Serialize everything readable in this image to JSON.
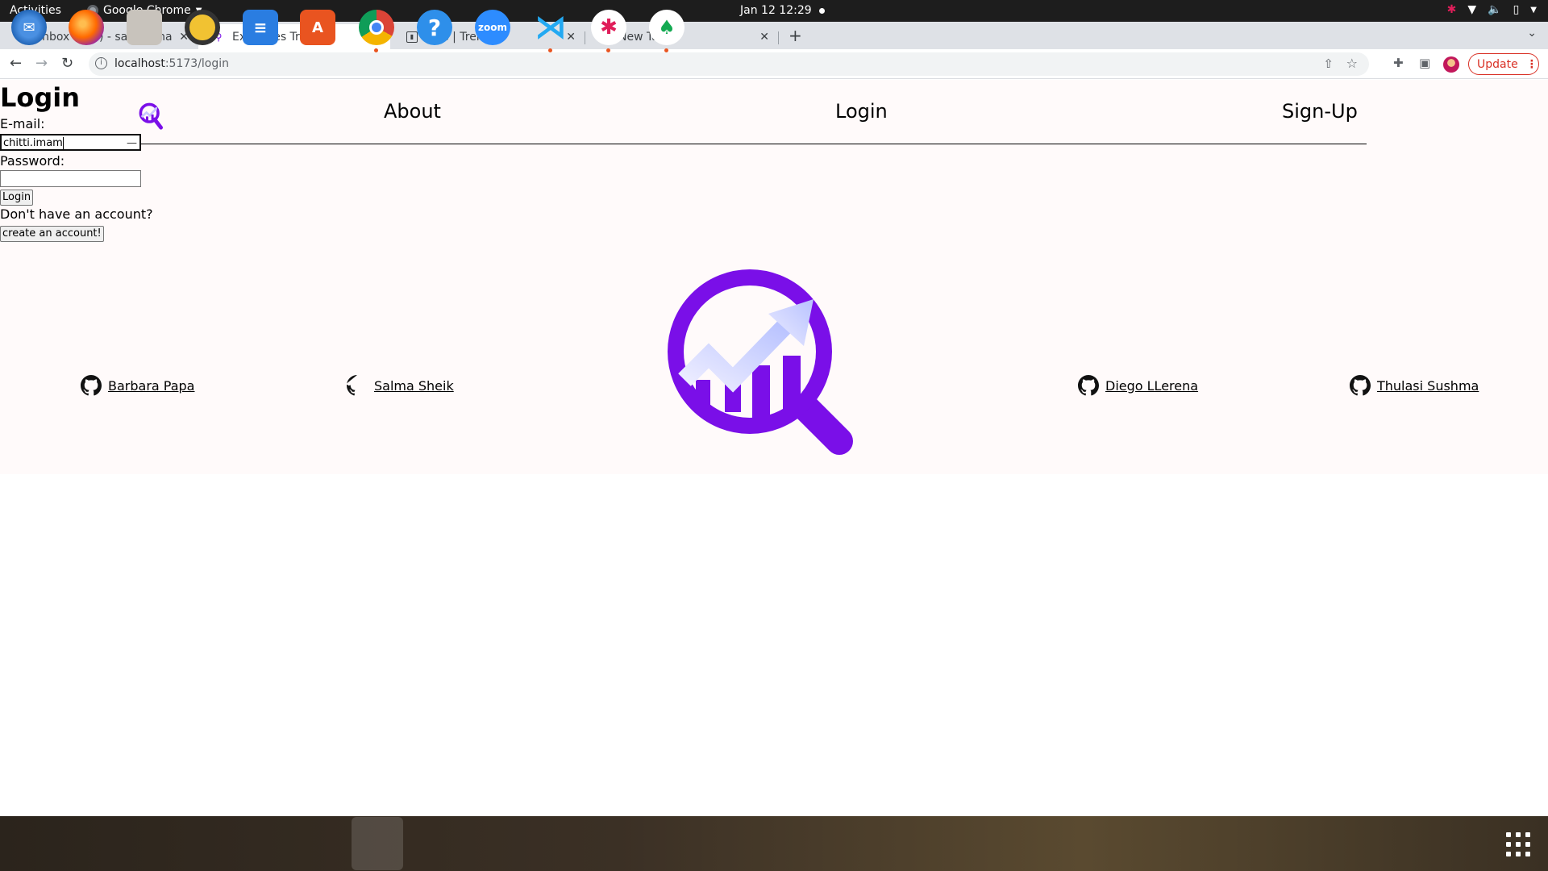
{
  "system": {
    "activities": "Activities",
    "app_name": "Google Chrome",
    "clock": "Jan 12  12:29"
  },
  "browser": {
    "tabs": [
      {
        "title": "Inbox (140) - salma.shaikh",
        "favicon": "gmail-icon",
        "active": false
      },
      {
        "title": "Expences Tracker",
        "favicon": "app-logo-icon",
        "active": true
      },
      {
        "title": "jobs | Trello",
        "favicon": "trello-icon",
        "active": false
      },
      {
        "title": "New Tab",
        "favicon": "chrome-icon",
        "active": false
      }
    ],
    "url_host": "localhost",
    "url_path": ":5173/login",
    "update_label": "Update",
    "accent": "#d93025"
  },
  "login_form": {
    "title": "Login",
    "email_label": "E-mail:",
    "email_value": "chitti.imam",
    "password_label": "Password:",
    "password_value": "",
    "login_button": "Login",
    "no_account_text": "Don't have an account?",
    "create_button": "create an account!"
  },
  "navbar": {
    "links": [
      "About",
      "Login",
      "Sign-Up"
    ]
  },
  "contributors": [
    "Barbara Papa",
    "Salma Sheik",
    "Diego LLerena",
    "Thulasi Sushma"
  ],
  "colors": {
    "brand": "#7a0fe8",
    "page_bg": "#fffafa"
  },
  "dock": {
    "apps": [
      "thunderbird-icon",
      "firefox-icon",
      "files-icon",
      "rhythmbox-icon",
      "writer-icon",
      "app-center-icon",
      "chrome-icon",
      "help-icon",
      "zoom-icon",
      "vscode-icon",
      "slack-icon",
      "mongodb-compass-icon"
    ],
    "zoom_label": "zoom"
  }
}
